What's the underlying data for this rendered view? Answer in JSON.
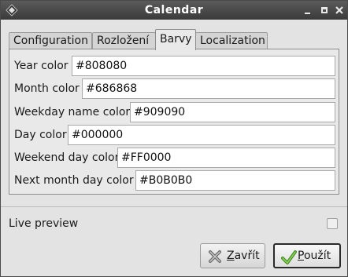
{
  "window": {
    "title": "Calendar",
    "icons": {
      "app": "app-menu-icon",
      "minimize": "minimize-icon",
      "maximize": "maximize-icon",
      "close": "close-icon"
    }
  },
  "tabs": [
    {
      "label": "Configuration",
      "active": false
    },
    {
      "label": "Rozložení",
      "active": false
    },
    {
      "label": "Barvy",
      "active": true
    },
    {
      "label": "Localization",
      "active": false
    }
  ],
  "colors": [
    {
      "label": "Year color",
      "value": "#808080"
    },
    {
      "label": "Month color",
      "value": "#686868"
    },
    {
      "label": "Weekday name color",
      "value": "#909090"
    },
    {
      "label": "Day color",
      "value": "#000000"
    },
    {
      "label": "Weekend day color",
      "value": "#FF0000"
    },
    {
      "label": "Next month day color",
      "value": "#B0B0B0"
    }
  ],
  "live_preview": {
    "label": "Live preview",
    "checked": false
  },
  "buttons": {
    "close": {
      "label_hotkey": "Z",
      "label_rest": "avřít",
      "icon": "x-cross-icon"
    },
    "apply": {
      "label_hotkey": "P",
      "label_rest": "oužít",
      "icon": "checkmark-icon"
    }
  }
}
